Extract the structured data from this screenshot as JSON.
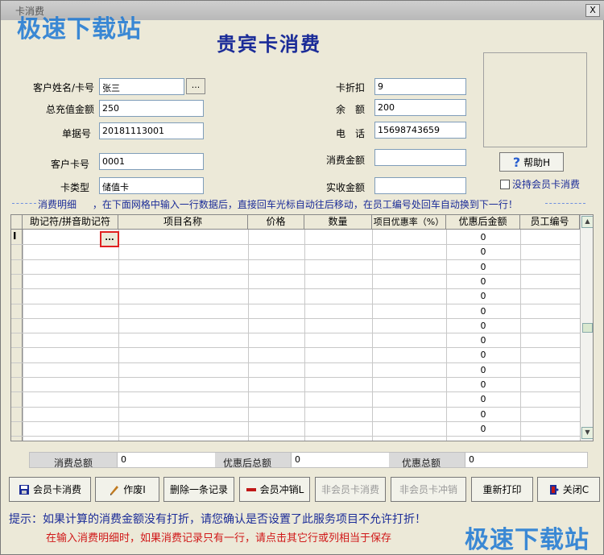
{
  "window": {
    "title": "卡消费",
    "close": "X"
  },
  "watermark": "极速下载站",
  "header": {
    "title": "贵宾卡消费"
  },
  "form": {
    "customer_name_label": "客户姓名/卡号",
    "customer_name_value": "张三",
    "browse_label": "...",
    "total_recharge_label": "总充值金额",
    "total_recharge_value": "250",
    "order_no_label": "单据号",
    "order_no_value": "20181113001",
    "customer_card_label": "客户卡号",
    "customer_card_value": "0001",
    "card_type_label": "卡类型",
    "card_type_value": "储值卡",
    "discount_label": "卡折扣",
    "discount_value": "9",
    "balance_label": "余　额",
    "balance_value": "200",
    "phone_label": "电　话",
    "phone_value": "15698743659",
    "consume_amount_label": "消费金额",
    "consume_amount_value": "",
    "received_amount_label": "实收金额",
    "received_amount_value": ""
  },
  "help_button": "帮助H",
  "no_card_checkbox": "没持会员卡消费",
  "detail": {
    "section_label": "消费明细",
    "instruction": "，在下面网格中输入一行数据后，直接回车光标自动往后移动，在员工编号处回车自动换到下一行！"
  },
  "grid": {
    "columns": [
      "助记符/拼音助记符",
      "项目名称",
      "价格",
      "数量",
      "项目优惠率（%）",
      "优惠后金额",
      "员工编号"
    ],
    "row_values": [
      "0",
      "0",
      "0",
      "0",
      "0",
      "0",
      "0",
      "0",
      "0",
      "0",
      "0",
      "0",
      "0",
      "0"
    ],
    "cell_button": "..."
  },
  "summary": {
    "total_label": "消费总额",
    "total_value": "0",
    "after_discount_label": "优惠后总额",
    "after_discount_value": "0",
    "discount_total_label": "优惠总额",
    "discount_total_value": "0"
  },
  "buttons": {
    "member_consume": "会员卡消费",
    "void": "作废I",
    "delete_record": "删除一条记录",
    "member_reverse": "会员冲销L",
    "non_member_consume": "非会员卡消费",
    "non_member_reverse": "非会员卡冲销",
    "reprint": "重新打印",
    "close": "关闭C"
  },
  "hints": {
    "hint1": "提示：如果计算的消费金额没有打折，请您确认是否设置了此服务项目不允许打折！",
    "hint2": "在输入消费明细时，如果消费记录只有一行，请点击其它行或列相当于保存"
  },
  "colors": {
    "accent_blue": "#1b2c98",
    "warning_red": "#d01818",
    "window_bg": "#ece9d8"
  }
}
